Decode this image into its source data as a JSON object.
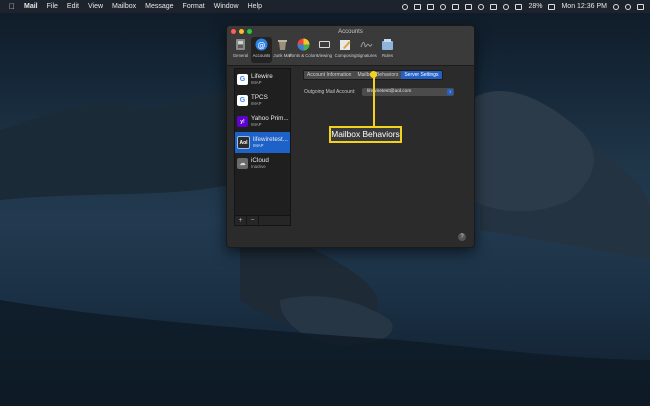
{
  "menubar": {
    "apple_icon": "apple-icon",
    "app_name": "Mail",
    "menus": [
      "File",
      "Edit",
      "View",
      "Mailbox",
      "Message",
      "Format",
      "Window",
      "Help"
    ],
    "battery": "28%",
    "clock": "Mon 12:36 PM"
  },
  "window": {
    "title": "Accounts",
    "toolbar": [
      {
        "label": "General",
        "icon": "switch-icon"
      },
      {
        "label": "Accounts",
        "icon": "at-icon"
      },
      {
        "label": "Junk Mail",
        "icon": "trash-icon"
      },
      {
        "label": "Fonts & Colors",
        "icon": "color-wheel-icon"
      },
      {
        "label": "Viewing",
        "icon": "glasses-icon"
      },
      {
        "label": "Composing",
        "icon": "pencil-icon"
      },
      {
        "label": "Signatures",
        "icon": "signature-icon"
      },
      {
        "label": "Rules",
        "icon": "rules-icon"
      }
    ],
    "accounts": [
      {
        "name": "Lifewire",
        "type": "IMAP",
        "icon": "google-icon"
      },
      {
        "name": "TPCS",
        "type": "IMAP",
        "icon": "google-icon"
      },
      {
        "name": "Yahoo Prim...",
        "type": "IMAP",
        "icon": "yahoo-icon"
      },
      {
        "name": "lifewiretest...",
        "type": "IMAP",
        "icon": "aol-icon"
      },
      {
        "name": "iCloud",
        "type": "Inactive",
        "icon": "icloud-icon"
      }
    ],
    "list_buttons": {
      "add": "+",
      "remove": "−"
    },
    "tabs": [
      "Account Information",
      "Mailbox Behaviors",
      "Server Settings"
    ],
    "outgoing_label": "Outgoing Mail Account:",
    "outgoing_value": "lifewiretest@aol.com",
    "help": "?"
  },
  "callout": {
    "text": "Mailbox Behaviors"
  },
  "colors": {
    "accent": "#1c62c8",
    "highlight": "#f2d21b"
  }
}
